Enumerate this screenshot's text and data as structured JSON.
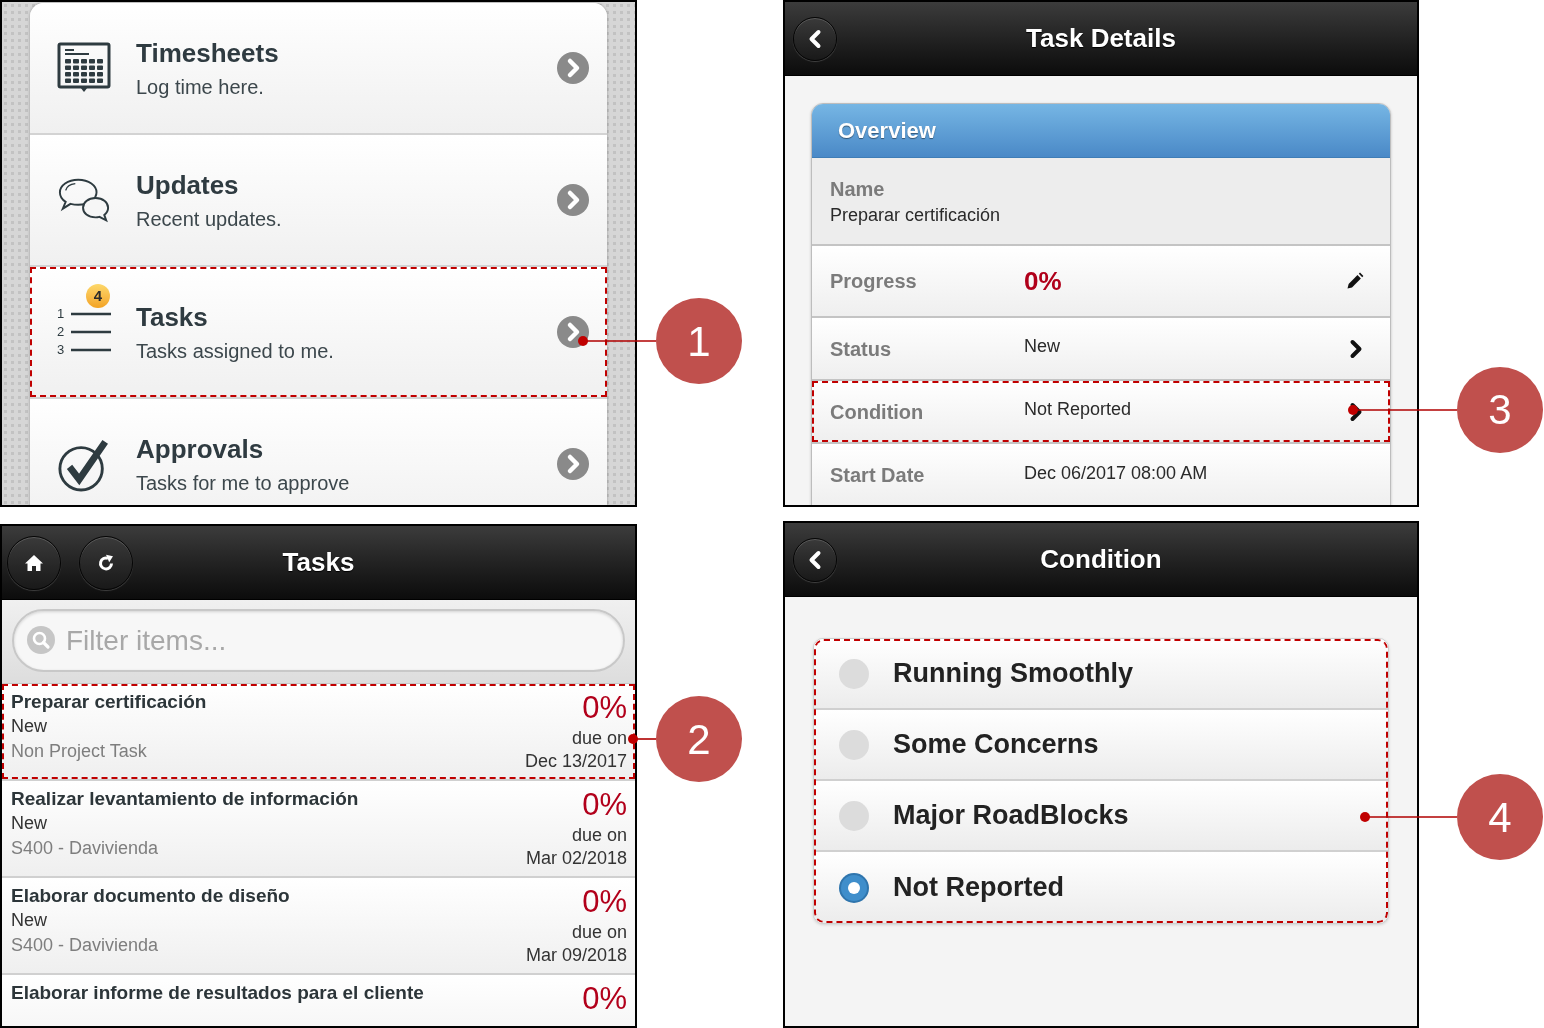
{
  "menu_screen": {
    "items": [
      {
        "title": "Timesheets",
        "subtitle": "Log time here."
      },
      {
        "title": "Updates",
        "subtitle": "Recent updates."
      },
      {
        "title": "Tasks",
        "subtitle": "Tasks assigned to me.",
        "badge": "4",
        "list_numbers": [
          "1",
          "2",
          "3"
        ],
        "callout": "1"
      },
      {
        "title": "Approvals",
        "subtitle": "Tasks for me to approve"
      }
    ]
  },
  "tasks_screen": {
    "title": "Tasks",
    "search": {
      "placeholder": "Filter items..."
    },
    "tasks": [
      {
        "name": "Preparar certificación",
        "status": "New",
        "project": "Non Project Task",
        "progress": "0%",
        "due_label": "due on",
        "due_date": "Dec 13/2017",
        "callout": "2"
      },
      {
        "name": "Realizar levantamiento de información",
        "status": "New",
        "project": "S400 - Davivienda",
        "progress": "0%",
        "due_label": "due on",
        "due_date": "Mar 02/2018"
      },
      {
        "name": "Elaborar documento de diseño",
        "status": "New",
        "project": "S400 - Davivienda",
        "progress": "0%",
        "due_label": "due on",
        "due_date": "Mar 09/2018"
      },
      {
        "name": "Elaborar informe de resultados para el cliente",
        "progress": "0%"
      }
    ]
  },
  "task_details_screen": {
    "title": "Task Details",
    "section_title": "Overview",
    "fields": [
      {
        "kind": "stacked",
        "label": "Name",
        "value": "Preparar certificación"
      },
      {
        "kind": "progress",
        "label": "Progress",
        "value": "0%"
      },
      {
        "kind": "link",
        "label": "Status",
        "value": "New"
      },
      {
        "kind": "link",
        "label": "Condition",
        "value": "Not Reported",
        "callout": "3"
      },
      {
        "kind": "plain",
        "label": "Start Date",
        "value": "Dec 06/2017 08:00 AM"
      }
    ]
  },
  "condition_screen": {
    "title": "Condition",
    "callout": "4",
    "options": [
      {
        "label": "Running Smoothly",
        "selected": false
      },
      {
        "label": "Some Concerns",
        "selected": false
      },
      {
        "label": "Major RoadBlocks",
        "selected": false
      },
      {
        "label": "Not Reported",
        "selected": true
      }
    ]
  }
}
